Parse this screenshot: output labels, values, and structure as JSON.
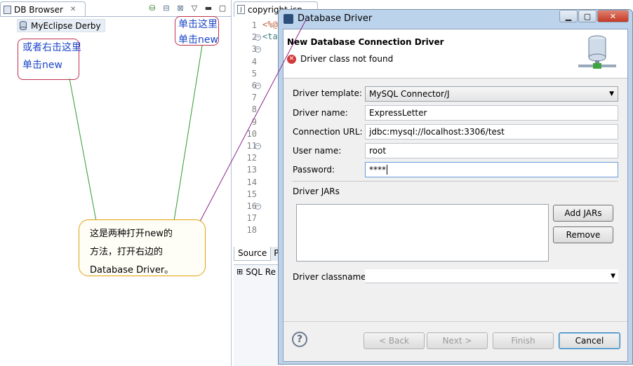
{
  "left_panel": {
    "tab_label": "DB Browser",
    "tree_item": "MyEclipse Derby"
  },
  "editor": {
    "tab_label": "copyright.jsp",
    "line_numbers": [
      "1",
      "2",
      "3",
      "4",
      "5",
      "6",
      "7",
      "8",
      "9",
      "10",
      "11",
      "12",
      "13",
      "14",
      "15",
      "16",
      "17",
      "18"
    ],
    "code_lines": [
      "<%@",
      "<ta"
    ],
    "source_tab": "Source",
    "source_tab_next": "Pr",
    "sql_results_tab": "SQL Re"
  },
  "dialog": {
    "title": "Database Driver",
    "header_title": "New Database Connection Driver",
    "error_message": "Driver class not found",
    "fields": {
      "driver_template_label": "Driver template:",
      "driver_template_value": "MySQL Connector/J",
      "driver_name_label": "Driver name:",
      "driver_name_value": "ExpressLetter",
      "connection_url_label": "Connection URL:",
      "connection_url_value": "jdbc:mysql://localhost:3306/test",
      "user_name_label": "User name:",
      "user_name_value": "root",
      "password_label": "Password:",
      "password_value": "****"
    },
    "driver_jars_label": "Driver JARs",
    "add_jars_button": "Add JARs",
    "remove_button": "Remove",
    "driver_classname_label": "Driver classname:",
    "back_button": "< Back",
    "next_button": "Next >",
    "finish_button": "Finish",
    "cancel_button": "Cancel",
    "help_glyph": "?"
  },
  "annotations": {
    "callout_left_line1": "或者右击这里",
    "callout_left_line2": "单击new",
    "callout_right_line1": "单击这里",
    "callout_right_line2": "单击new",
    "bubble_line1": "这是两种打开new的",
    "bubble_line2": "方法，打开右边的",
    "bubble_line3": "Database Driver。"
  },
  "icons": {
    "db_browser_tab": "database-view-icon",
    "tree_item": "database-cylinder-icon",
    "editor_tab": "jsp-file-icon",
    "dialog_title": "myeclipse-logo-icon",
    "error": "error-x-icon",
    "header_image": "database-connection-icon",
    "help": "help-question-icon"
  },
  "colors": {
    "annotation_red": "#c0304c",
    "annotation_blue": "#1b45c8",
    "bubble_border": "#e0a010",
    "connector_green": "#2e9a2e",
    "connector_purple": "#8a2a8a",
    "error_red": "#d23a3a"
  }
}
